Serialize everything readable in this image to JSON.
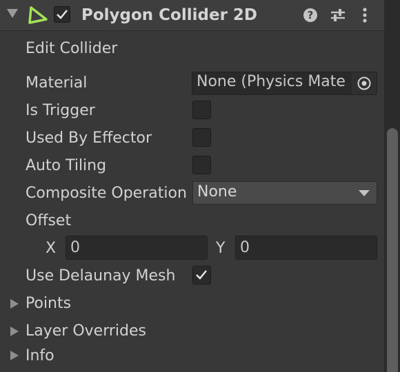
{
  "header": {
    "title": "Polygon Collider 2D",
    "enabled": true,
    "icons": [
      "polygon-collider-icon",
      "help-icon",
      "presets-icon",
      "kebab-menu-icon"
    ]
  },
  "edit_collider": {
    "label": "Edit Collider"
  },
  "material": {
    "label": "Material",
    "value": "None (Physics Mate"
  },
  "is_trigger": {
    "label": "Is Trigger",
    "checked": false
  },
  "used_by_effector": {
    "label": "Used By Effector",
    "checked": false
  },
  "auto_tiling": {
    "label": "Auto Tiling",
    "checked": false
  },
  "composite_operation": {
    "label": "Composite Operation",
    "value": "None"
  },
  "offset": {
    "label": "Offset",
    "x_label": "X",
    "x_value": "0",
    "y_label": "Y",
    "y_value": "0"
  },
  "use_delaunay_mesh": {
    "label": "Use Delaunay Mesh",
    "checked": true
  },
  "foldouts": {
    "points": "Points",
    "layer_overrides": "Layer Overrides",
    "info": "Info"
  },
  "colors": {
    "background": "#383838",
    "header": "#3e3e3e",
    "accent_icon": "#a4e356",
    "field": "#2a2a2a"
  }
}
